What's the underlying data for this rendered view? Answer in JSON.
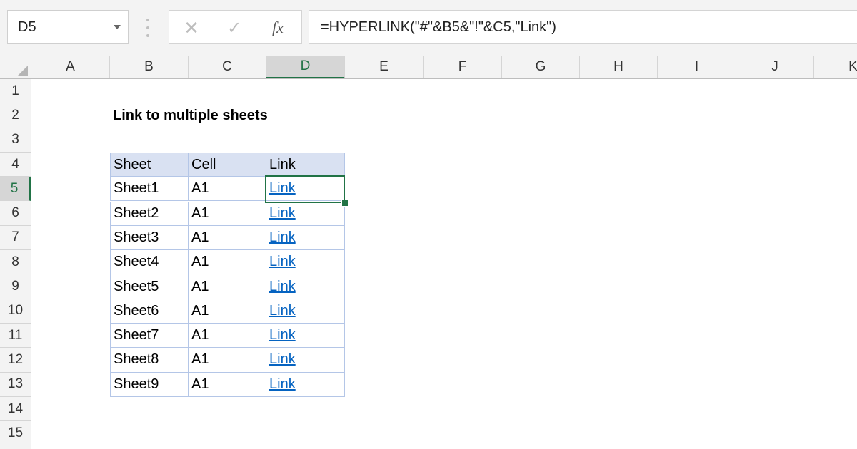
{
  "formula_bar": {
    "name_box": "D5",
    "formula": "=HYPERLINK(\"#\"&B5&\"!\"&C5,\"Link\")",
    "fx_label": "fx",
    "icons": [
      "cancel-icon",
      "enter-icon",
      "fx-icon",
      "dropdown-icon"
    ]
  },
  "columns": [
    "A",
    "B",
    "C",
    "D",
    "E",
    "F",
    "G",
    "H",
    "I",
    "J",
    "K"
  ],
  "active_column": "D",
  "rows": [
    "1",
    "2",
    "3",
    "4",
    "5",
    "6",
    "7",
    "8",
    "9",
    "10",
    "11",
    "12",
    "13",
    "14",
    "15"
  ],
  "active_row": "5",
  "sheet": {
    "title": "Link to multiple sheets",
    "table": {
      "headers": [
        "Sheet",
        "Cell",
        "Link"
      ],
      "rows": [
        [
          "Sheet1",
          "A1",
          "Link"
        ],
        [
          "Sheet2",
          "A1",
          "Link"
        ],
        [
          "Sheet3",
          "A1",
          "Link"
        ],
        [
          "Sheet4",
          "A1",
          "Link"
        ],
        [
          "Sheet5",
          "A1",
          "Link"
        ],
        [
          "Sheet6",
          "A1",
          "Link"
        ],
        [
          "Sheet7",
          "A1",
          "Link"
        ],
        [
          "Sheet8",
          "A1",
          "Link"
        ],
        [
          "Sheet9",
          "A1",
          "Link"
        ]
      ]
    }
  },
  "colors": {
    "accent_green": "#217346",
    "header_fill": "#d9e1f2",
    "hyperlink": "#0563c1"
  }
}
